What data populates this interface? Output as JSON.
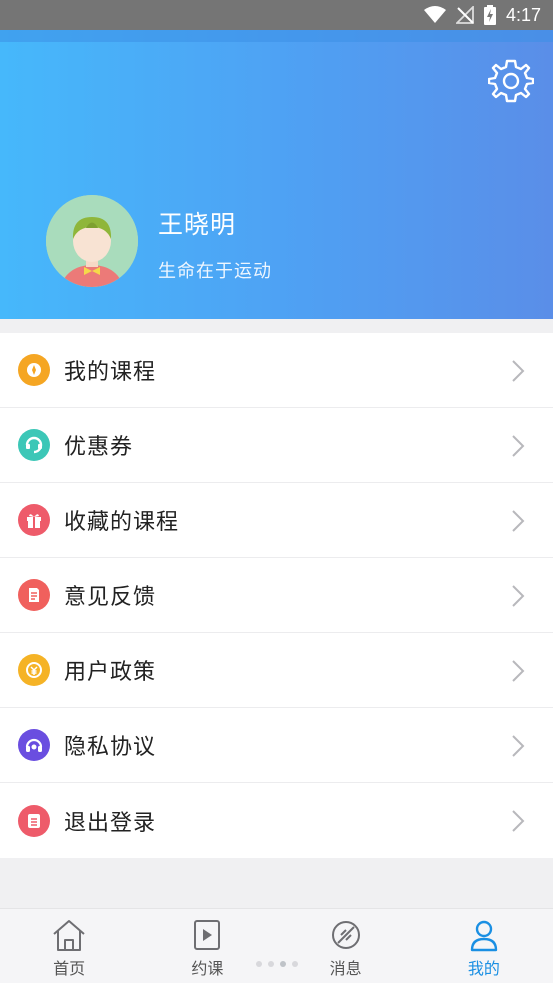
{
  "status_bar": {
    "time": "4:17",
    "icons": [
      "wifi-icon",
      "no-signal-icon",
      "battery-charging-icon"
    ]
  },
  "header": {
    "settings_icon": "gear-icon",
    "avatar": "avatar-icon",
    "user_name": "王晓明",
    "motto": "生命在于运动"
  },
  "menu": {
    "items": [
      {
        "label": "我的课程",
        "icon": "course-icon",
        "color": "#f5a623"
      },
      {
        "label": "优惠券",
        "icon": "coupon-icon",
        "color": "#3cc7b7"
      },
      {
        "label": "收藏的课程",
        "icon": "gift-icon",
        "color": "#ee5b6a"
      },
      {
        "label": "意见反馈",
        "icon": "feedback-icon",
        "color": "#f0605d"
      },
      {
        "label": "用户政策",
        "icon": "policy-icon",
        "color": "#f5b326"
      },
      {
        "label": "隐私协议",
        "icon": "headset-icon",
        "color": "#6a4ee0"
      },
      {
        "label": "退出登录",
        "icon": "logout-icon",
        "color": "#ee5b6a"
      }
    ]
  },
  "tabbar": {
    "tabs": [
      {
        "label": "首页",
        "icon": "home-icon"
      },
      {
        "label": "约课",
        "icon": "play-icon"
      },
      {
        "label": "消息",
        "icon": "message-icon"
      },
      {
        "label": "我的",
        "icon": "user-icon"
      }
    ],
    "active": "我的",
    "active_color": "#1a8fe3"
  }
}
